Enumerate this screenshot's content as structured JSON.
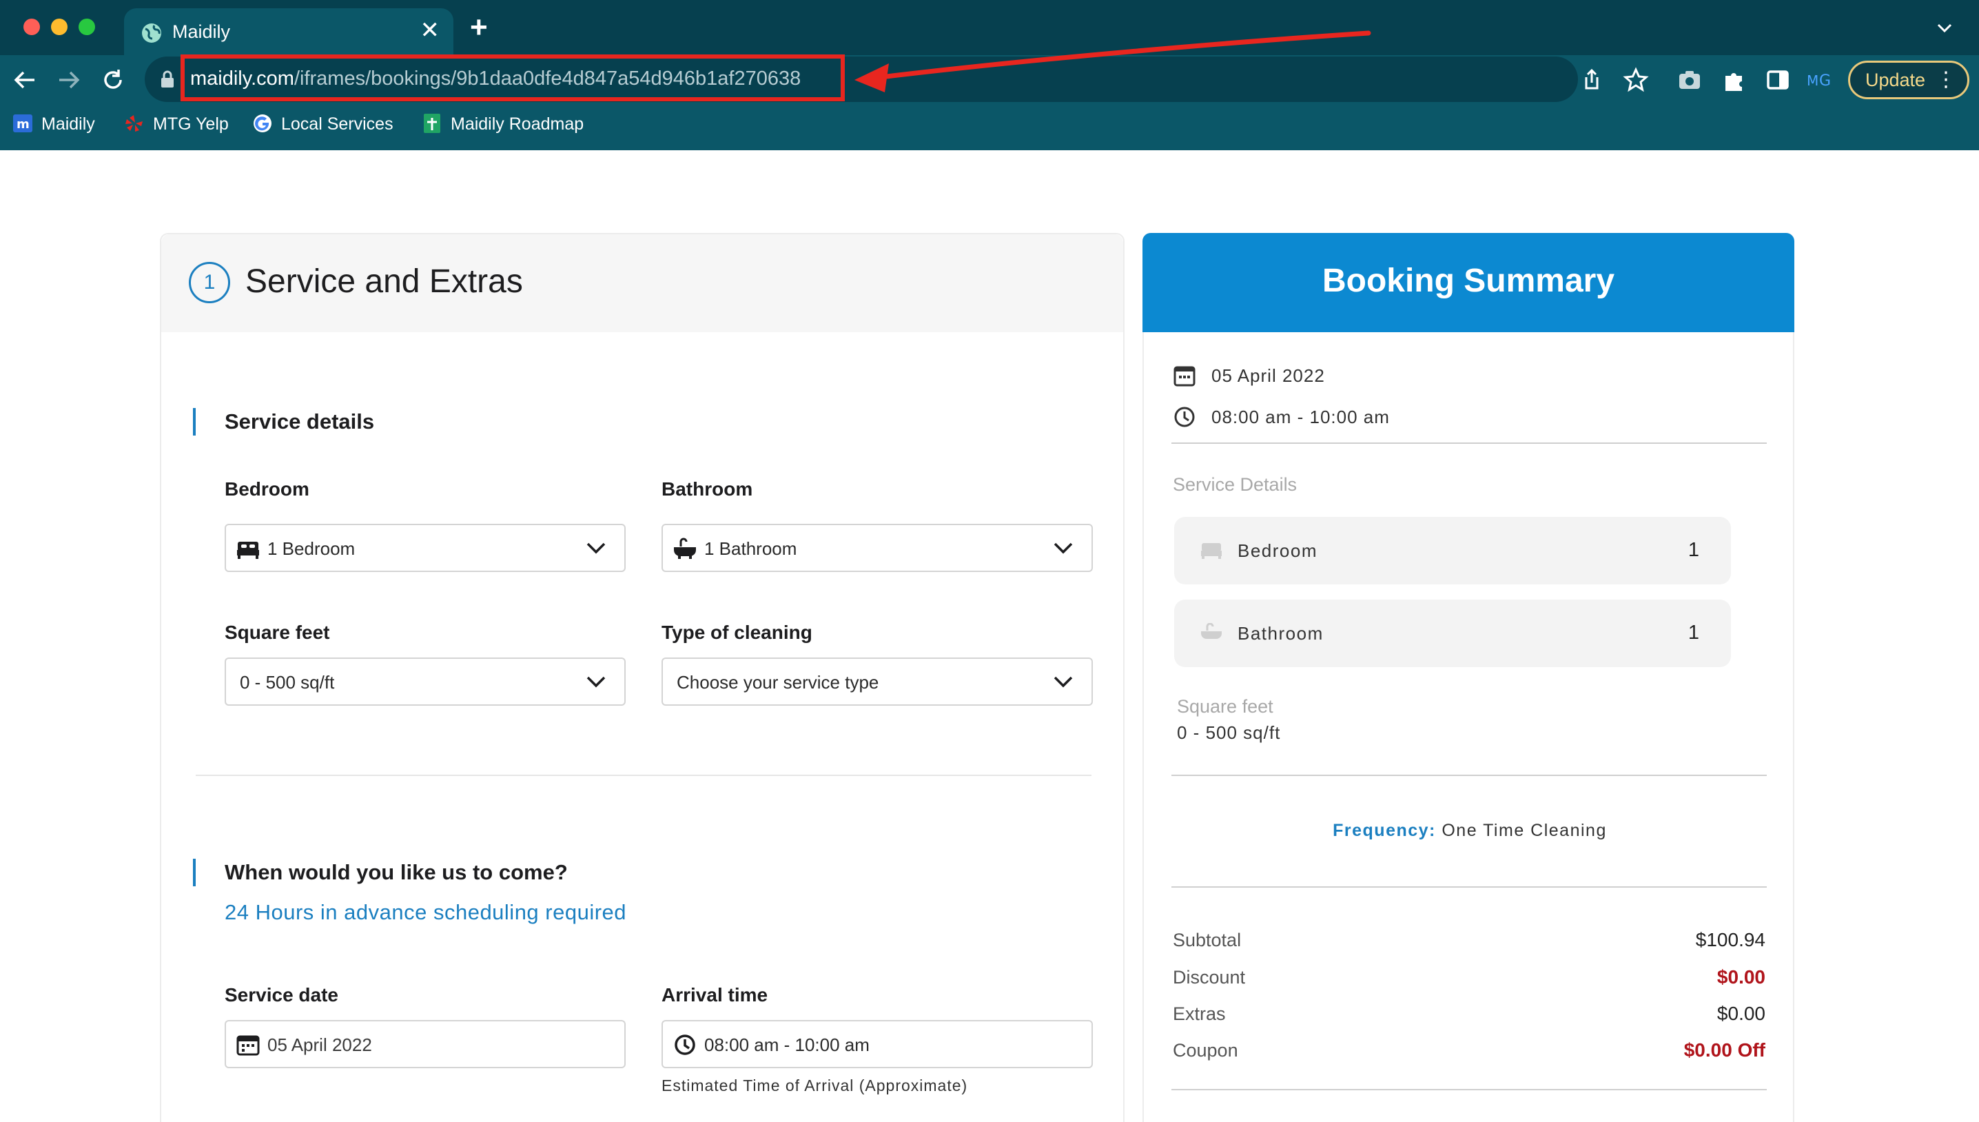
{
  "browser": {
    "tab_title": "Maidily",
    "tab_close": "✕",
    "new_tab": "+",
    "url_host": "maidily.com",
    "url_path": "/iframes/bookings/9b1daa0dfe4d847a54d946b1af270638",
    "update_label": "Update",
    "menu_dots": "⋮",
    "bookmarks": [
      {
        "label": "Maidily",
        "icon": "maidily-logo-icon"
      },
      {
        "label": "MTG Yelp",
        "icon": "yelp-icon"
      },
      {
        "label": "Local Services",
        "icon": "google-icon"
      },
      {
        "label": "Maidily Roadmap",
        "icon": "sheets-icon"
      }
    ],
    "accent_color": "#e8261f"
  },
  "booking": {
    "step_number": "1",
    "section_title": "Service and Extras",
    "service_details_heading": "Service details",
    "bedroom": {
      "label": "Bedroom",
      "value": "1 Bedroom"
    },
    "bathroom": {
      "label": "Bathroom",
      "value": "1 Bathroom"
    },
    "square_feet": {
      "label": "Square feet",
      "value": "0 - 500 sq/ft"
    },
    "cleaning_type": {
      "label": "Type of cleaning",
      "value": "Choose your service type"
    },
    "when_heading": "When would you like us to come?",
    "advance_note": "24 Hours in advance scheduling required",
    "service_date": {
      "label": "Service date",
      "value": "05 April 2022"
    },
    "arrival_time": {
      "label": "Arrival time",
      "value": "08:00 am - 10:00 am",
      "helper": "Estimated Time of Arrival (Approximate)"
    }
  },
  "summary": {
    "title": "Booking Summary",
    "date": "05 April 2022",
    "time": "08:00 am - 10:00 am",
    "service_details_label": "Service Details",
    "bedroom_label": "Bedroom",
    "bedroom_count": "1",
    "bathroom_label": "Bathroom",
    "bathroom_count": "1",
    "square_feet_label": "Square feet",
    "square_feet_value": "0 - 500 sq/ft",
    "frequency_label": "Frequency:",
    "frequency_value": "One Time Cleaning",
    "subtotal_label": "Subtotal",
    "subtotal_value": "$100.94",
    "discount_label": "Discount",
    "discount_value": "$0.00",
    "extras_label": "Extras",
    "extras_value": "$0.00",
    "coupon_label": "Coupon",
    "coupon_value": "$0.00 Off",
    "header_color": "#0c89d1",
    "negative_color": "#b0141b"
  }
}
